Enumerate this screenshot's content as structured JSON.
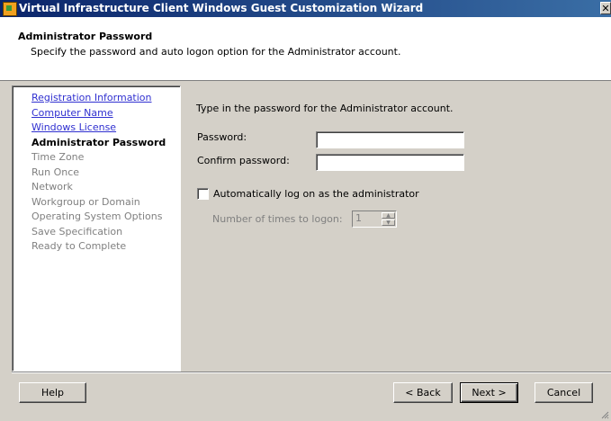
{
  "window": {
    "title": "Virtual Infrastructure Client Windows Guest Customization Wizard",
    "close_glyph": "✕"
  },
  "header": {
    "title": "Administrator Password",
    "subtitle": "Specify the password and auto logon option for the Administrator account."
  },
  "sidebar": {
    "items": [
      {
        "label": "Registration Information",
        "state": "visited"
      },
      {
        "label": "Computer Name",
        "state": "visited"
      },
      {
        "label": "Windows License",
        "state": "visited"
      },
      {
        "label": "Administrator Password",
        "state": "current"
      },
      {
        "label": "Time Zone",
        "state": "disabled"
      },
      {
        "label": "Run Once",
        "state": "disabled"
      },
      {
        "label": "Network",
        "state": "disabled"
      },
      {
        "label": "Workgroup or Domain",
        "state": "disabled"
      },
      {
        "label": "Operating System Options",
        "state": "disabled"
      },
      {
        "label": "Save Specification",
        "state": "disabled"
      },
      {
        "label": "Ready to Complete",
        "state": "disabled"
      }
    ]
  },
  "form": {
    "instruction": "Type in the password for the Administrator account.",
    "password_label": "Password:",
    "password_value": "",
    "confirm_label": "Confirm password:",
    "confirm_value": "",
    "autologon_label": "Automatically log on as the administrator",
    "autologon_checked": false,
    "logon_count_label": "Number of times to logon:",
    "logon_count_value": "1"
  },
  "buttons": {
    "help": "Help",
    "back": "< Back",
    "next": "Next >",
    "cancel": "Cancel"
  }
}
